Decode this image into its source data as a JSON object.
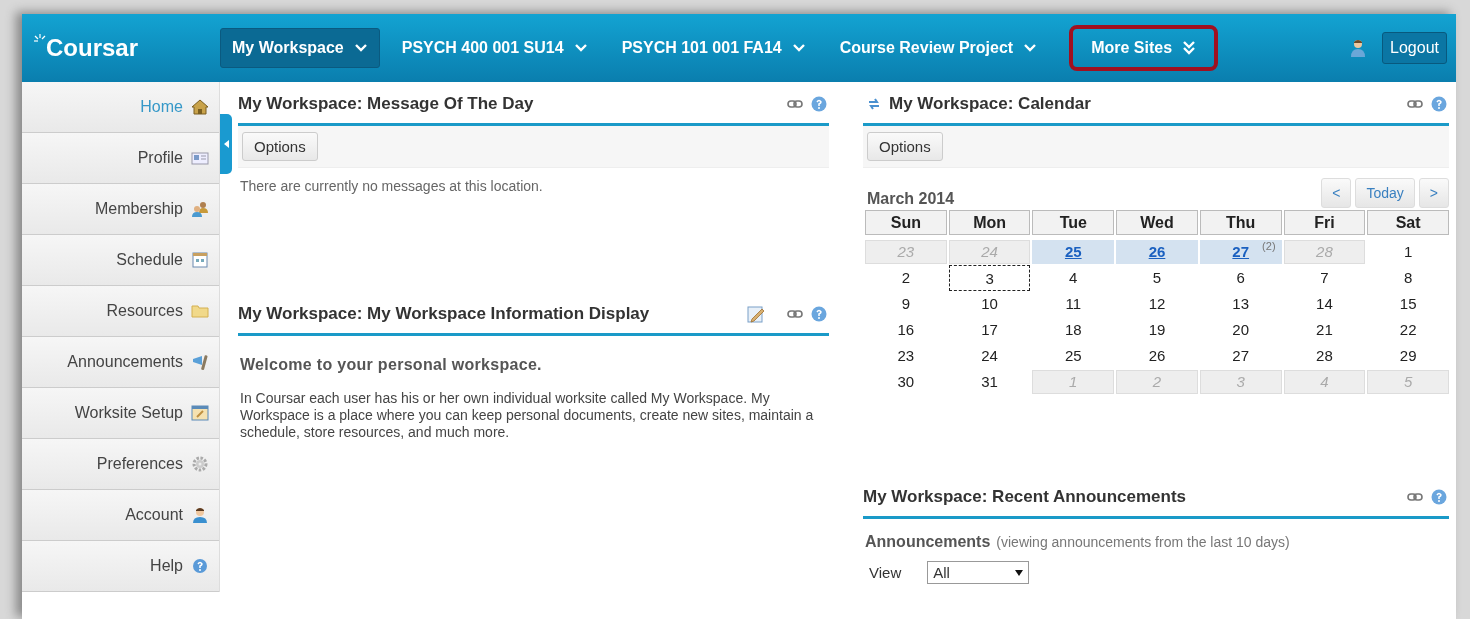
{
  "header": {
    "logo": "Coursar",
    "tabs": [
      {
        "label": "My Workspace",
        "selected": true,
        "highlighted": false
      },
      {
        "label": "PSYCH 400 001 SU14",
        "selected": false,
        "highlighted": false
      },
      {
        "label": "PSYCH 101 001 FA14",
        "selected": false,
        "highlighted": false
      },
      {
        "label": "Course Review Project",
        "selected": false,
        "highlighted": false
      },
      {
        "label": "More Sites",
        "selected": false,
        "highlighted": true
      }
    ],
    "logout": "Logout"
  },
  "sidebar": {
    "items": [
      {
        "label": "Home",
        "selected": true
      },
      {
        "label": "Profile",
        "selected": false
      },
      {
        "label": "Membership",
        "selected": false
      },
      {
        "label": "Schedule",
        "selected": false
      },
      {
        "label": "Resources",
        "selected": false
      },
      {
        "label": "Announcements",
        "selected": false
      },
      {
        "label": "Worksite Setup",
        "selected": false
      },
      {
        "label": "Preferences",
        "selected": false
      },
      {
        "label": "Account",
        "selected": false
      },
      {
        "label": "Help",
        "selected": false
      }
    ]
  },
  "message_of_the_day": {
    "title": "My Workspace: Message Of The Day",
    "options": "Options",
    "text": "There are currently no messages at this location."
  },
  "information_display": {
    "title": "My Workspace: My Workspace Information Display",
    "heading": "Welcome to your personal workspace.",
    "text": "In Coursar each user has his or her own individual worksite called My Workspace. My Workspace is a place where you can keep personal documents, create new sites, maintain a schedule, store resources, and much more."
  },
  "calendar": {
    "title": "My Workspace: Calendar",
    "options": "Options",
    "month": "March 2014",
    "nav": [
      "<",
      "Today",
      ">"
    ],
    "weekdays": [
      "Sun",
      "Mon",
      "Tue",
      "Wed",
      "Thu",
      "Fri",
      "Sat"
    ],
    "weeks": [
      [
        {
          "day": "23",
          "kind": "other"
        },
        {
          "day": "24",
          "kind": "other"
        },
        {
          "day": "25",
          "kind": "event"
        },
        {
          "day": "26",
          "kind": "event"
        },
        {
          "day": "27",
          "kind": "event",
          "badge": "(2)"
        },
        {
          "day": "28",
          "kind": "other"
        },
        {
          "day": "1",
          "kind": "normal"
        }
      ],
      [
        {
          "day": "2",
          "kind": "normal"
        },
        {
          "day": "3",
          "kind": "today"
        },
        {
          "day": "4",
          "kind": "normal"
        },
        {
          "day": "5",
          "kind": "normal"
        },
        {
          "day": "6",
          "kind": "normal"
        },
        {
          "day": "7",
          "kind": "normal"
        },
        {
          "day": "8",
          "kind": "normal"
        }
      ],
      [
        {
          "day": "9",
          "kind": "normal"
        },
        {
          "day": "10",
          "kind": "normal"
        },
        {
          "day": "11",
          "kind": "normal"
        },
        {
          "day": "12",
          "kind": "normal"
        },
        {
          "day": "13",
          "kind": "normal"
        },
        {
          "day": "14",
          "kind": "normal"
        },
        {
          "day": "15",
          "kind": "normal"
        }
      ],
      [
        {
          "day": "16",
          "kind": "normal"
        },
        {
          "day": "17",
          "kind": "normal"
        },
        {
          "day": "18",
          "kind": "normal"
        },
        {
          "day": "19",
          "kind": "normal"
        },
        {
          "day": "20",
          "kind": "normal"
        },
        {
          "day": "21",
          "kind": "normal"
        },
        {
          "day": "22",
          "kind": "normal"
        }
      ],
      [
        {
          "day": "23",
          "kind": "normal"
        },
        {
          "day": "24",
          "kind": "normal"
        },
        {
          "day": "25",
          "kind": "normal"
        },
        {
          "day": "26",
          "kind": "normal"
        },
        {
          "day": "27",
          "kind": "normal"
        },
        {
          "day": "28",
          "kind": "normal"
        },
        {
          "day": "29",
          "kind": "normal"
        }
      ],
      [
        {
          "day": "30",
          "kind": "normal"
        },
        {
          "day": "31",
          "kind": "normal"
        },
        {
          "day": "1",
          "kind": "other"
        },
        {
          "day": "2",
          "kind": "other"
        },
        {
          "day": "3",
          "kind": "other"
        },
        {
          "day": "4",
          "kind": "other"
        },
        {
          "day": "5",
          "kind": "other"
        }
      ]
    ]
  },
  "recent_announcements": {
    "title": "My Workspace: Recent Announcements",
    "label": "Announcements",
    "note": "(viewing announcements from the last 10 days)",
    "view_label": "View",
    "view_value": "All"
  }
}
